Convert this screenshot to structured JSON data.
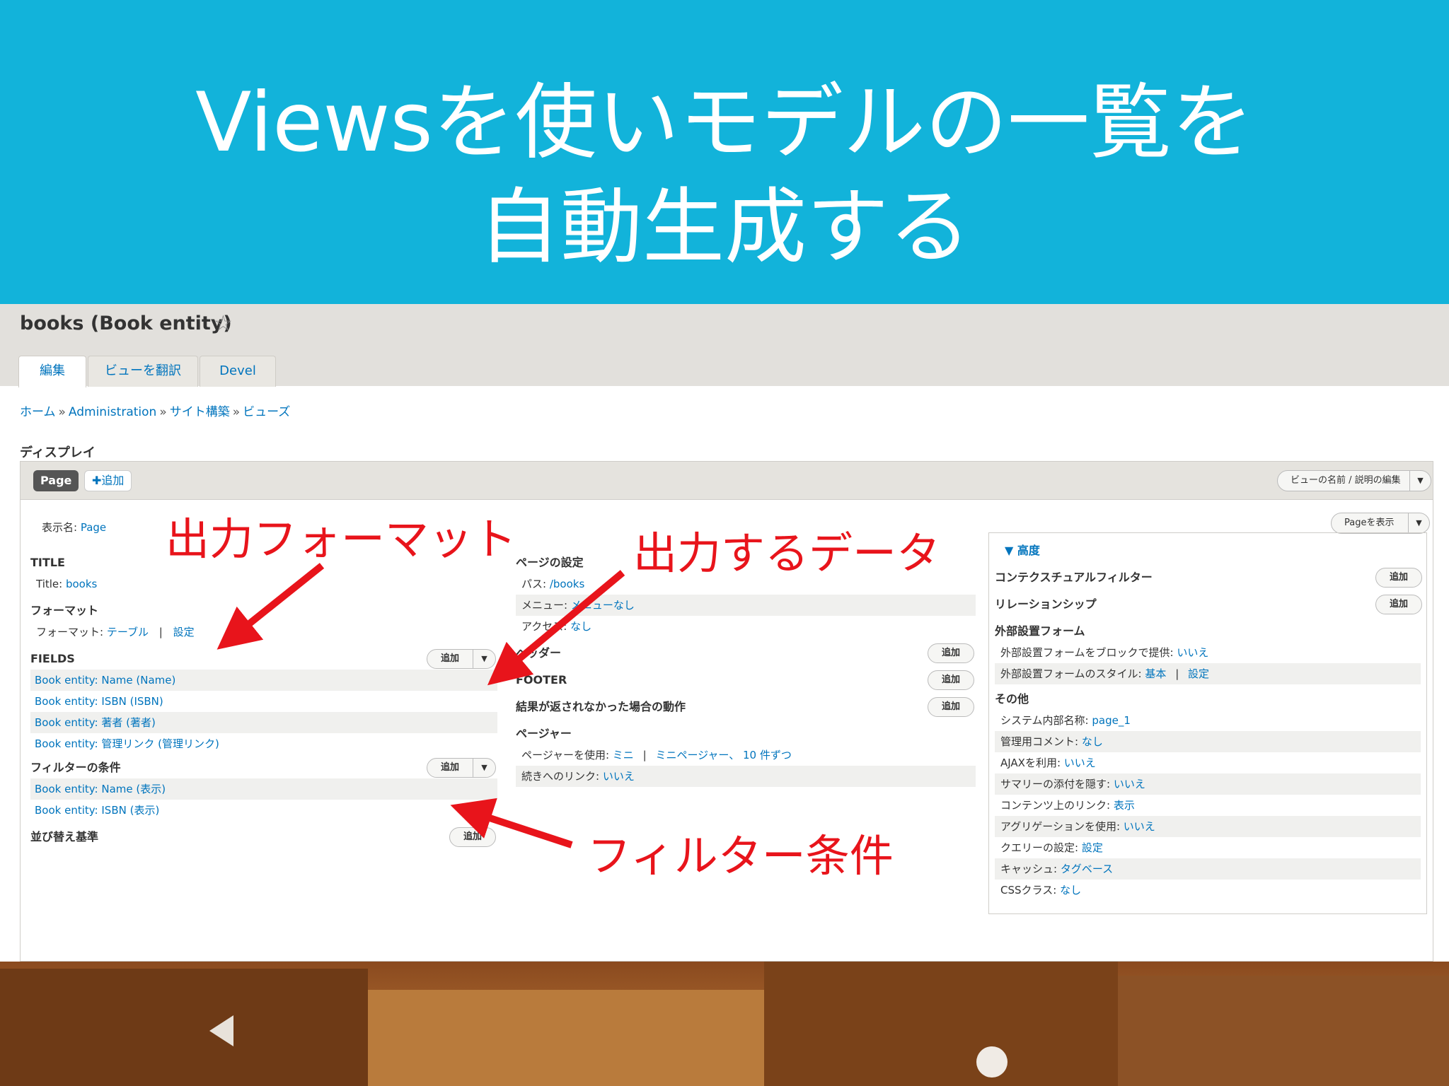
{
  "slide": {
    "title_line1": "Viewsを使いモデルの一覧を",
    "title_line2": "自動生成する"
  },
  "header": {
    "view_title": "books (Book entity)",
    "tabs": [
      {
        "label": "編集",
        "active": true
      },
      {
        "label": "ビューを翻訳",
        "active": false
      },
      {
        "label": "Devel",
        "active": false
      }
    ]
  },
  "breadcrumb": [
    "ホーム",
    "Administration",
    "サイト構築",
    "ビューズ"
  ],
  "breadcrumb_sep": "»",
  "display": {
    "heading": "ディスプレイ",
    "page_pill": "Page",
    "add_label": "✚追加",
    "edit_name_btn": "ビューの名前 / 説明の編集",
    "display_name_label": "表示名:",
    "display_name_value": "Page",
    "show_page_btn": "Pageを表示"
  },
  "left_col": {
    "title_head": "TITLE",
    "title_label": "Title:",
    "title_value": "books",
    "format_head": "フォーマット",
    "format_label": "フォーマット:",
    "format_value": "テーブル",
    "format_sep": "|",
    "format_settings": "設定",
    "fields_head": "FIELDS",
    "fields": [
      "Book entity: Name (Name)",
      "Book entity: ISBN (ISBN)",
      "Book entity: 著者 (著者)",
      "Book entity: 管理リンク (管理リンク)"
    ],
    "filter_head": "フィルターの条件",
    "filters": [
      "Book entity: Name (表示)",
      "Book entity: ISBN (表示)"
    ],
    "sort_head": "並び替え基準",
    "add_label": "追加"
  },
  "mid_col": {
    "page_settings_head": "ページの設定",
    "path_label": "パス:",
    "path_value": "/books",
    "menu_label": "メニュー:",
    "menu_value": "メニューなし",
    "access_label": "アクセス:",
    "access_value": "なし",
    "header_head": "ヘッダー",
    "footer_head": "FOOTER",
    "no_results_head": "結果が返されなかった場合の動作",
    "pager_head": "ページャー",
    "pager_label": "ページャーを使用:",
    "pager_value1": "ミニ",
    "pager_sep": "|",
    "pager_value2": "ミニページャー、 10 件ずつ",
    "more_label": "続きへのリンク:",
    "more_value": "いいえ",
    "add_label": "追加"
  },
  "right_col": {
    "advanced_head": "▼ 高度",
    "contextual_head": "コンテクスチュアルフィルター",
    "relationships_head": "リレーションシップ",
    "exposed_head": "外部設置フォーム",
    "exposed_block_label": "外部設置フォームをブロックで提供:",
    "exposed_block_value": "いいえ",
    "exposed_style_label": "外部設置フォームのスタイル:",
    "exposed_style_value": "基本",
    "exposed_style_sep": "|",
    "exposed_style_settings": "設定",
    "other_head": "その他",
    "other_rows": [
      {
        "label": "システム内部名称:",
        "value": "page_1"
      },
      {
        "label": "管理用コメント:",
        "value": "なし"
      },
      {
        "label": "AJAXを利用:",
        "value": "いいえ"
      },
      {
        "label": "サマリーの添付を隠す:",
        "value": "いいえ"
      },
      {
        "label": "コンテンツ上のリンク:",
        "value": "表示"
      },
      {
        "label": "アグリゲーションを使用:",
        "value": "いいえ"
      },
      {
        "label": "クエリーの設定:",
        "value": "設定"
      },
      {
        "label": "キャッシュ:",
        "value": "タグベース"
      },
      {
        "label": "CSSクラス:",
        "value": "なし"
      }
    ],
    "add_label": "追加"
  },
  "annotations": {
    "output_format": "出力フォーマット",
    "output_data": "出力するデータ",
    "filter_condition": "フィルター条件"
  },
  "colors": {
    "title_band": "#12b3da",
    "annotation_red": "#e8141b",
    "link_blue": "#0074bd"
  },
  "icons": [
    "star-icon",
    "caret-down-icon",
    "arrow-icon",
    "photo-background"
  ]
}
